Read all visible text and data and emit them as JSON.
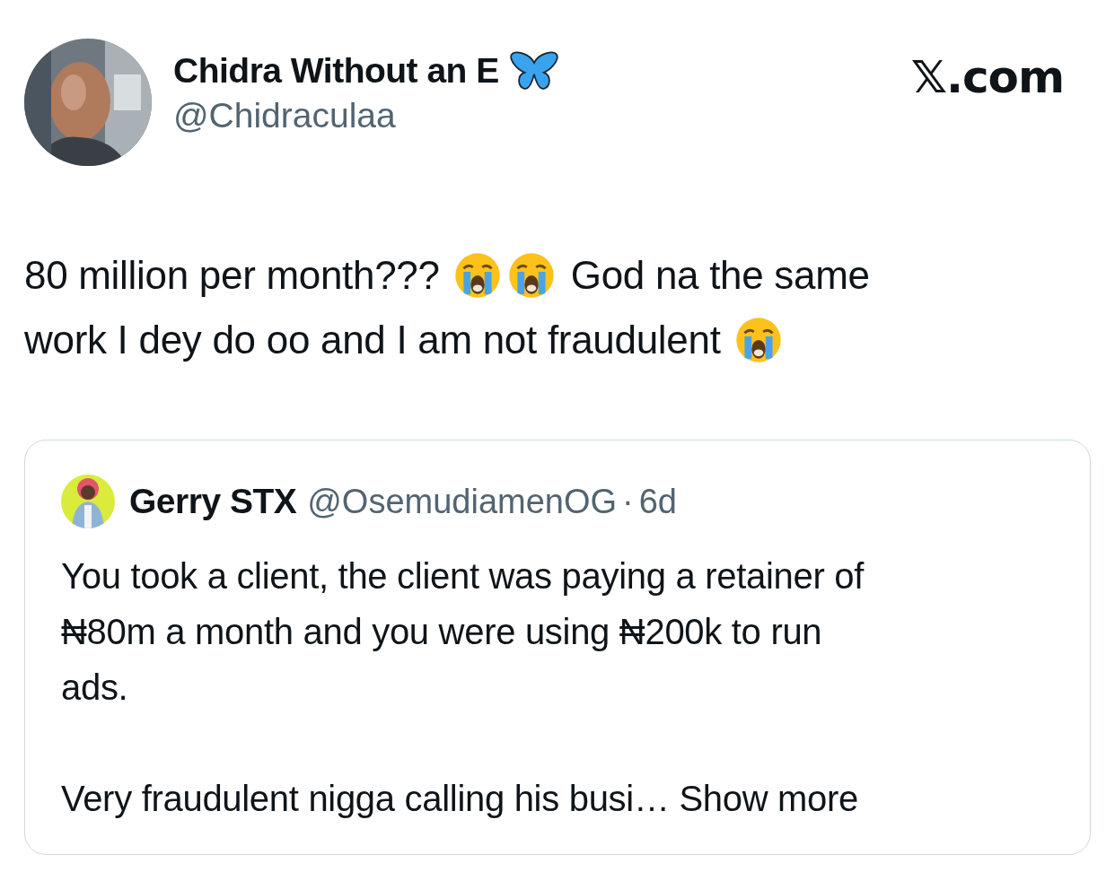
{
  "author": {
    "name": "Chidra Without an E",
    "handle": "@Chidraculaa"
  },
  "source": "𝕏.com",
  "text_lines": [
    [
      {
        "kind": "text",
        "text": "80 million per month???"
      },
      {
        "kind": "emoji"
      },
      {
        "kind": "emoji"
      },
      {
        "kind": "text",
        "text": "God na the same"
      }
    ],
    [
      {
        "kind": "text",
        "text": "work I dey do oo and I am not fraudulent"
      },
      {
        "kind": "emoji"
      }
    ]
  ],
  "quote": {
    "name": "Gerry STX",
    "handle": "@OsemudiamenOG",
    "separator": "·",
    "time": "6d",
    "body": "You took a client, the client was paying a retainer of\n₦80m a month and you were using ₦200k to run\nads.",
    "last_line": "Very fraudulent nigga calling his busi…",
    "show_more": "Show more"
  }
}
